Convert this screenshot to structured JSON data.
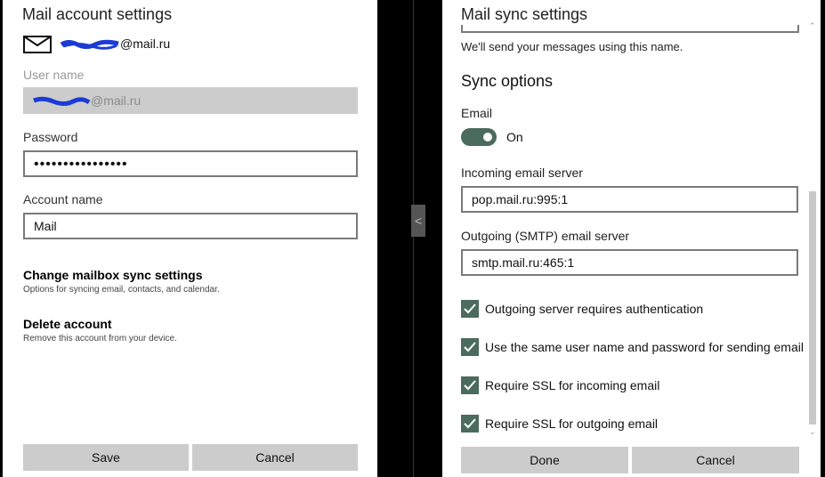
{
  "left_dialog": {
    "title": "Mail account settings",
    "email_suffix": "@mail.ru",
    "user_name_label": "User name",
    "user_name_suffix": "@mail.ru",
    "password_label": "Password",
    "password_value": "••••••••••••••••",
    "account_name_label": "Account name",
    "account_name_value": "Mail",
    "change_sync_title": "Change mailbox sync settings",
    "change_sync_sub": "Options for syncing email, contacts, and calendar.",
    "delete_title": "Delete account",
    "delete_sub": "Remove this account from your device.",
    "save_label": "Save",
    "cancel_label": "Cancel"
  },
  "right_dialog": {
    "title": "Mail sync settings",
    "send_note": "We'll send your messages using this name.",
    "sync_options_heading": "Sync options",
    "email_label": "Email",
    "email_toggle_state": "On",
    "incoming_label": "Incoming email server",
    "incoming_value": "pop.mail.ru:995:1",
    "outgoing_label": "Outgoing (SMTP) email server",
    "outgoing_value": "smtp.mail.ru:465:1",
    "checkboxes": [
      {
        "label": "Outgoing server requires authentication",
        "checked": true
      },
      {
        "label": "Use the same user name and password for sending email",
        "checked": true
      },
      {
        "label": "Require SSL for incoming email",
        "checked": true
      },
      {
        "label": "Require SSL for outgoing email",
        "checked": true
      }
    ],
    "done_label": "Done",
    "cancel_label": "Cancel"
  },
  "splitter": {
    "arrow": "<"
  },
  "icons": {
    "mail": "mail-envelope-icon",
    "check": "checkmark-icon",
    "redaction": "redaction-scribble"
  },
  "colors": {
    "accent": "#4a6b5d",
    "button_bg": "#cccccc",
    "redaction": "#1a3bd6"
  }
}
